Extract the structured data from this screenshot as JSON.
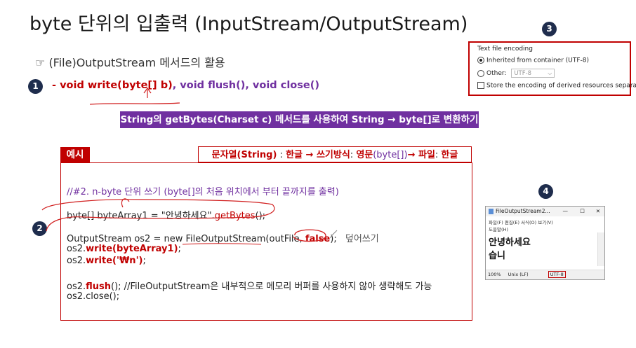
{
  "title": "byte 단위의 입출력 (InputStream/OutputStream)",
  "subtitle": {
    "bullet": "☞",
    "text": "(File)OutputStream 메서드의 활용"
  },
  "badges": {
    "one": "1",
    "two": "2",
    "three": "3",
    "four": "4"
  },
  "methods": {
    "dash": "- ",
    "write_name": "void write(",
    "write_param": "byte[] b)",
    "rest": ", void flush(), void close()"
  },
  "banner": "String의 getBytes(Charset c) 메서드를 사용하여 String → byte[]로 변환하기",
  "example_label": "예시",
  "string_box": {
    "p1": "문자열(String)",
    "p2": " : ",
    "p3": "한글 → 쓰기방식",
    "p4": ": ",
    "p5": "영문",
    "p6": "(byte[])",
    "p7": "→ 파일",
    "p8": ": ",
    "p9": "한글"
  },
  "code": {
    "comment1": "//#2. n-byte 단위 쓰기 (byte[]의 처음 위치에서 부터 끝까지를 출력)",
    "line2a": "byte[] byteArray1 = \"안녕하세요\".",
    "line2b": "getBytes",
    "line2c": "();",
    "line3a": "OutputStream os2 = new FileOutputStream(outFile, ",
    "line3b": "false",
    "line3c": ");",
    "line3d": "덮어쓰기",
    "line4a": "os2.",
    "line4b": "write(byteArray1)",
    "line4c": ";",
    "line5a": "os2.",
    "line5b": "write('₩n')",
    "line5c": ";",
    "line6a": "os2.",
    "line6b": "flush",
    "line6c": "(); //FileOutputStream은 내부적으로 메모리 버퍼를 사용하지 않아 생략해도 가능",
    "line7": "os2.close();"
  },
  "encoding_panel": {
    "heading": "Text file encoding",
    "inherited": "Inherited from container (UTF-8)",
    "other_label": "Other:",
    "other_value": "UTF-8",
    "store": "Store the encoding of derived resources separately"
  },
  "notepad": {
    "title": "FileOutputStream2...",
    "menu1": "파일(F)  편집(E)  서식(O)  보기(V)",
    "menu2": "도움말(H)",
    "line1": "안녕하세요",
    "line2": "습니",
    "status_zoom": "100%",
    "status_eol": "Unix (LF)",
    "status_enc": "UTF-8"
  },
  "colors": {
    "accent_red": "#c00000",
    "purple": "#7030a0",
    "navy": "#1f2d4d"
  }
}
